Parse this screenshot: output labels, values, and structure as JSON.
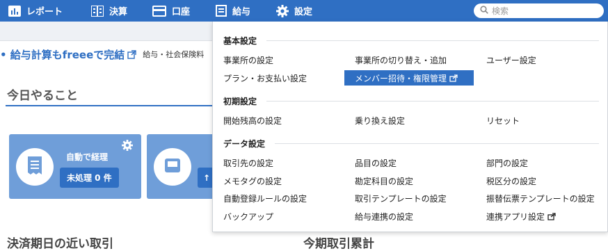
{
  "nav": {
    "report": "レポート",
    "settlement": "決算",
    "account": "口座",
    "payroll": "給与",
    "settings": "設定",
    "search_placeholder": "検索"
  },
  "page": {
    "promo_link": "• 給与計算もfreeeで完結",
    "promo_text": "給与・社会保険料",
    "today_title": "今日やること",
    "card1_title": "自動で経理",
    "card1_button": "未処理 0 件",
    "card2_button_fragment": "↑",
    "bottom_left_title": "決済期日の近い取引",
    "bottom_right_title": "今期取引累計"
  },
  "settings_menu": {
    "basic": {
      "heading": "基本設定",
      "items": [
        "事業所の設定",
        "事業所の切り替え・追加",
        "ユーザー設定",
        "プラン・お支払い設定",
        "メンバー招待・権限管理"
      ]
    },
    "initial": {
      "heading": "初期設定",
      "items": [
        "開始残高の設定",
        "乗り換え設定",
        "リセット"
      ]
    },
    "data": {
      "heading": "データ設定",
      "items": [
        "取引先の設定",
        "品目の設定",
        "部門の設定",
        "メモタグの設定",
        "勘定科目の設定",
        "税区分の設定",
        "自動登録ルールの設定",
        "取引テンプレートの設定",
        "振替伝票テンプレートの設定",
        "バックアップ",
        "給与連携の設定",
        "連携アプリ設定"
      ]
    }
  },
  "colors": {
    "nav_bg": "#2f6fc3",
    "active_item_bg": "#2f6fc3",
    "card_bg": "#6f9ed9"
  }
}
